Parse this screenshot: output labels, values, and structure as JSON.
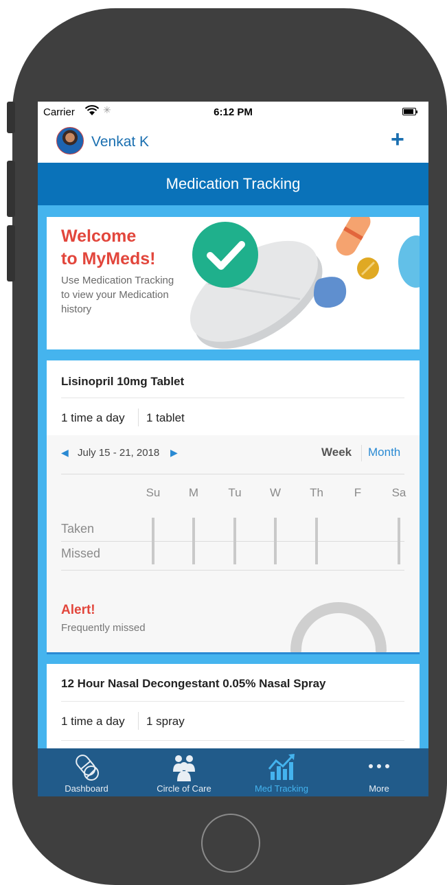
{
  "status_bar": {
    "carrier": "Carrier",
    "time": "6:12 PM"
  },
  "nav": {
    "user_name": "Venkat K",
    "add_icon": "plus-icon"
  },
  "header": {
    "title": "Medication Tracking"
  },
  "welcome": {
    "title_line1": "Welcome",
    "title_line2": "to MyMeds!",
    "subtitle": "Use Medication Tracking to view your Medication history"
  },
  "medications": [
    {
      "name": "Lisinopril 10mg Tablet",
      "frequency": "1 time a day",
      "dose": "1 tablet",
      "date_range": "July 15 - 21, 2018",
      "view_week": "Week",
      "view_month": "Month",
      "days": [
        "Su",
        "M",
        "Tu",
        "W",
        "Th",
        "F",
        "Sa"
      ],
      "row_taken": "Taken",
      "row_missed": "Missed",
      "alert_title": "Alert!",
      "alert_subtitle": "Frequently missed"
    },
    {
      "name": "12 Hour Nasal Decongestant 0.05% Nasal Spray",
      "frequency": "1 time a day",
      "dose": "1 spray"
    }
  ],
  "tabs": [
    {
      "label": "Dashboard",
      "icon": "pills-icon"
    },
    {
      "label": "Circle of Care",
      "icon": "people-icon"
    },
    {
      "label": "Med Tracking",
      "icon": "chart-trend-icon",
      "active": true
    },
    {
      "label": "More",
      "icon": "more-dots-icon"
    }
  ],
  "colors": {
    "primary": "#0a72b9",
    "light_blue": "#45b4ee",
    "alert_red": "#e2463c",
    "tabbar": "#215b8a"
  }
}
